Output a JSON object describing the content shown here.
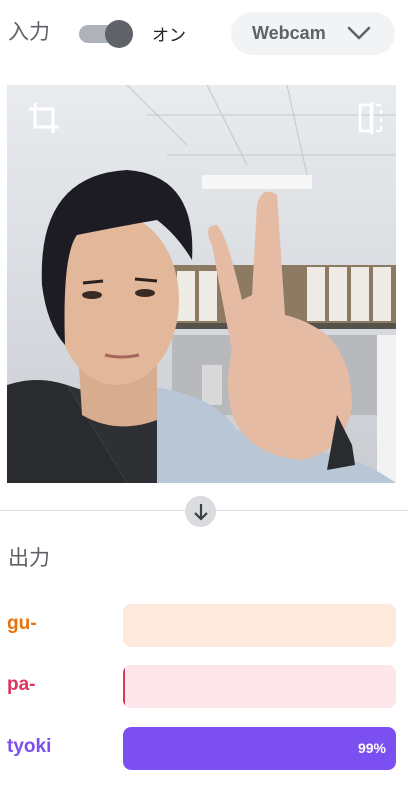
{
  "header": {
    "input_label": "入力",
    "toggle_state": "オン",
    "toggle_on": true,
    "source_select": {
      "selected": "Webcam"
    }
  },
  "preview": {
    "crop_icon": "crop-icon",
    "flip_icon": "flip-icon"
  },
  "arrow_icon": "arrow-down-icon",
  "output": {
    "label": "出力",
    "classes": [
      {
        "name": "gu-",
        "percent": 0,
        "label": "",
        "text_color": "#e8710a",
        "track_color": "#fdeadc",
        "fill_color": "#e8710a"
      },
      {
        "name": "pa-",
        "percent": 0.5,
        "label": "",
        "text_color": "#d93660",
        "track_color": "#fde6e9",
        "fill_color": "#d93660"
      },
      {
        "name": "tyoki",
        "percent": 99,
        "label": "99%",
        "text_color": "#7b4ff0",
        "track_color": "#efe8fd",
        "fill_color": "#7b4ff0"
      }
    ]
  }
}
